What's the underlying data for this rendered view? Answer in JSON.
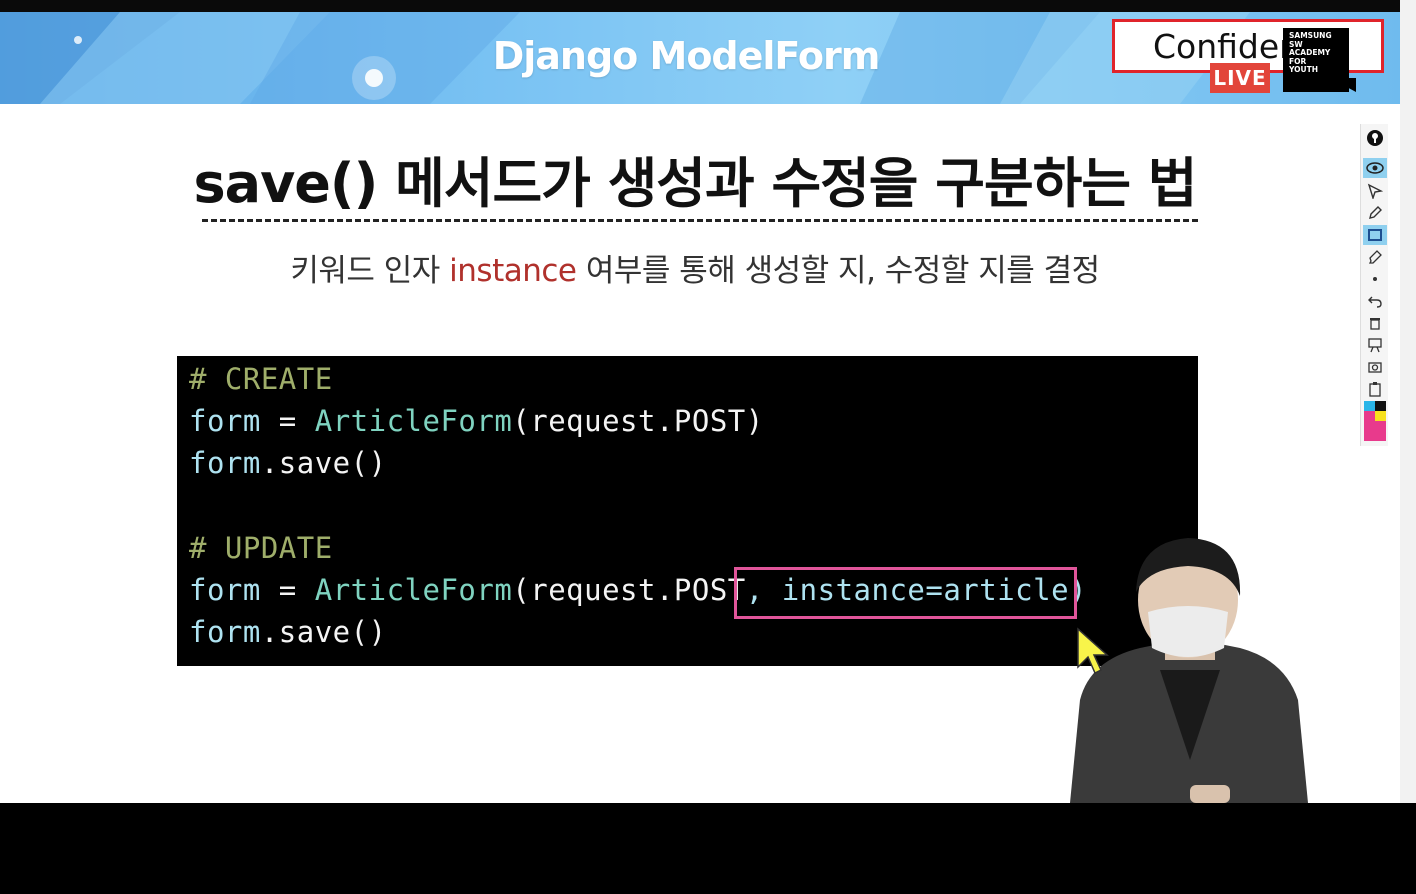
{
  "banner": {
    "title": "Django ModelForm"
  },
  "badge": {
    "label": "Confider",
    "live": "LIVE",
    "academy": [
      "SAMSUNG",
      "SW",
      "ACADEMY",
      "FOR",
      "YOUTH"
    ]
  },
  "slide": {
    "heading": "save() 메서드가 생성과 수정을 구분하는 법",
    "subtitle_before": "키워드 인자 ",
    "subtitle_keyword": "instance",
    "subtitle_after": " 여부를 통해 생성할 지, 수정할 지를 결정"
  },
  "code": {
    "create_comment": "# CREATE",
    "create_line_var": "form",
    "create_line_eq": " = ",
    "create_line_class": "ArticleForm",
    "create_line_args": "(request.POST)",
    "create_save_var": "form",
    "create_save_call": ".save()",
    "update_comment": "# UPDATE",
    "update_line_var": "form",
    "update_line_eq": " = ",
    "update_line_class": "ArticleForm",
    "update_line_args": "(request.POST",
    "update_line_kwarg": ", instance=article)",
    "update_save_var": "form",
    "update_save_call": ".save()"
  },
  "toolbar": {
    "tools": [
      "info-icon",
      "eye-icon",
      "arrow-pointer-icon",
      "pen-icon",
      "rectangle-icon",
      "highlighter-icon",
      "dot-icon",
      "undo-icon",
      "trash-icon",
      "whiteboard-icon",
      "camera-icon",
      "clipboard-icon",
      "color-palette-icon"
    ],
    "active_tools": [
      "eye-icon",
      "rectangle-icon"
    ]
  },
  "colors": {
    "banner": "#6fbbee",
    "badge_border": "#e0242b",
    "live": "#e2453a",
    "keyword": "#b0312c",
    "highlight": "#e0559a",
    "comment": "#9fae6a",
    "class": "#7fd3c0"
  }
}
